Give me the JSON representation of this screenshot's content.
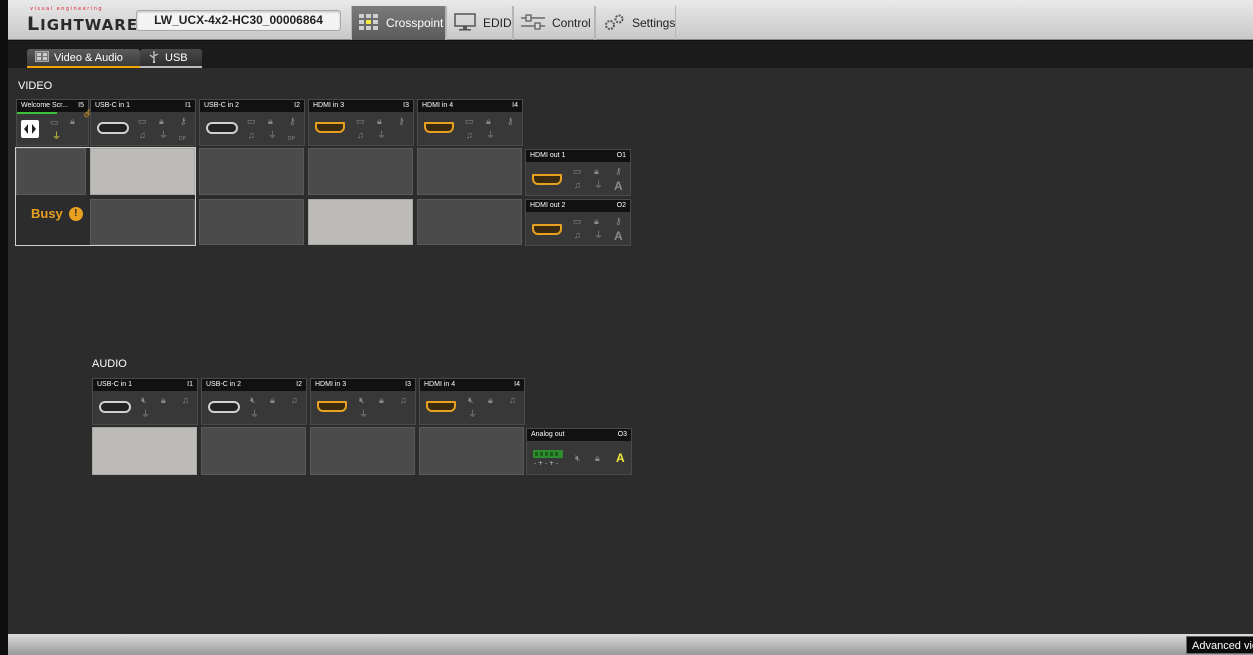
{
  "header": {
    "brand_tag": "visual engineering",
    "brand_initial": "L",
    "brand_rest": "IGHTWARE",
    "device_name": "LW_UCX-4x2-HC30_00006864",
    "tabs": [
      {
        "label": "Crosspoint",
        "icon": "crosspoint-grid-icon",
        "active": true
      },
      {
        "label": "EDID",
        "icon": "monitor-icon",
        "active": false
      },
      {
        "label": "Control",
        "icon": "sliders-icon",
        "active": false
      },
      {
        "label": "Settings",
        "icon": "gears-icon",
        "active": false
      }
    ]
  },
  "subtabs": [
    {
      "label": "Video & Audio",
      "icon": "av-icon",
      "active": true
    },
    {
      "label": "USB",
      "icon": "usb-icon",
      "active": false
    }
  ],
  "video": {
    "section_label": "VIDEO",
    "inputs": [
      {
        "name": "Welcome Scr...",
        "id": "I5"
      },
      {
        "name": "USB-C in 1",
        "id": "I1"
      },
      {
        "name": "USB-C in 2",
        "id": "I2"
      },
      {
        "name": "HDMI in 3",
        "id": "I3"
      },
      {
        "name": "HDMI in 4",
        "id": "I4"
      }
    ],
    "outputs": [
      {
        "name": "HDMI out 1",
        "id": "O1"
      },
      {
        "name": "HDMI out 2",
        "id": "O2"
      }
    ],
    "busy_label": "Busy",
    "busy_mark": "!",
    "connections": [
      [
        false,
        true,
        false,
        false,
        false
      ],
      [
        false,
        false,
        false,
        true,
        false
      ]
    ],
    "dp_label": "DP",
    "a_label": "A"
  },
  "audio": {
    "section_label": "AUDIO",
    "inputs": [
      {
        "name": "USB-C in 1",
        "id": "I1"
      },
      {
        "name": "USB-C in 2",
        "id": "I2"
      },
      {
        "name": "HDMI in 3",
        "id": "I3"
      },
      {
        "name": "HDMI in 4",
        "id": "I4"
      }
    ],
    "outputs": [
      {
        "name": "Analog out",
        "id": "O3"
      }
    ],
    "connections": [
      [
        true,
        false,
        false,
        false
      ]
    ],
    "a_label": "A"
  },
  "footer": {
    "advanced_view_label": "Advanced vie"
  },
  "colors": {
    "accent": "#f0a500",
    "active_cell": "#bcbbb7",
    "inactive_cell": "#4b4b4b",
    "highlight_yellow": "#f2ea3c"
  }
}
